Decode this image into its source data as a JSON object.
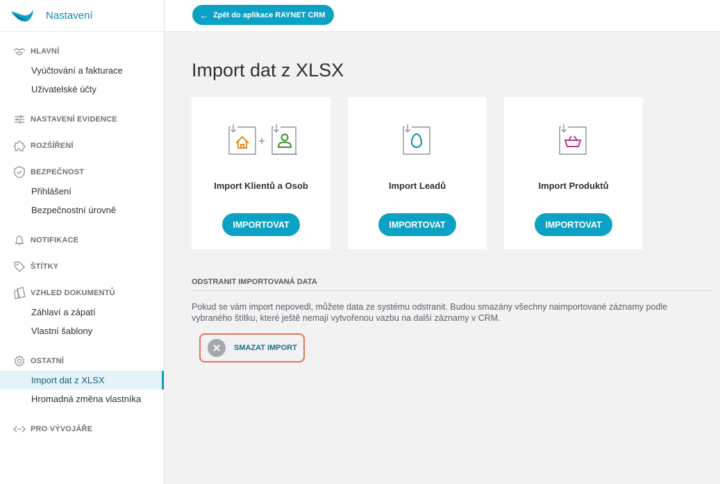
{
  "sidebar": {
    "brand_title": "Nastavení",
    "sections": [
      {
        "label": "HLAVNÍ",
        "icon": "handshake-icon",
        "items": [
          "Vyúčtování a fakturace",
          "Uživatelské účty"
        ]
      },
      {
        "label": "NASTAVENÍ EVIDENCE",
        "icon": "sliders-icon",
        "items": []
      },
      {
        "label": "ROZŠÍŘENÍ",
        "icon": "puzzle-icon",
        "items": []
      },
      {
        "label": "BEZPEČNOST",
        "icon": "shield-icon",
        "items": [
          "Přihlášení",
          "Bezpečnostní úrovně"
        ]
      },
      {
        "label": "NOTIFIKACE",
        "icon": "bell-icon",
        "items": []
      },
      {
        "label": "ŠTÍTKY",
        "icon": "tag-icon",
        "items": []
      },
      {
        "label": "VZHLED DOKUMENTŮ",
        "icon": "documents-icon",
        "items": [
          "Záhlaví a zápatí",
          "Vlastní šablony"
        ]
      },
      {
        "label": "OSTATNÍ",
        "icon": "gear-icon",
        "items": [
          "Import dat z XLSX",
          "Hromadná změna vlastníka"
        ]
      },
      {
        "label": "PRO VÝVOJÁŘE",
        "icon": "code-icon",
        "items": []
      }
    ],
    "active_item": "Import dat z XLSX"
  },
  "topbar": {
    "back_label": "Zpět do aplikace RAYNET CRM"
  },
  "main": {
    "title": "Import dat z XLSX",
    "cards": [
      {
        "title": "Import Klientů a Osob",
        "button": "IMPORTOVAT",
        "icons": [
          "house-icon",
          "person-icon"
        ]
      },
      {
        "title": "Import Leadů",
        "button": "IMPORTOVAT",
        "icons": [
          "egg-icon"
        ]
      },
      {
        "title": "Import Produktů",
        "button": "IMPORTOVAT",
        "icons": [
          "basket-icon"
        ]
      }
    ],
    "remove": {
      "heading": "ODSTRANIT IMPORTOVANÁ DATA",
      "description": "Pokud se vám import nepovedl, můžete data ze systému odstranit. Budou smazány všechny naimportované záznamy podle vybraného štítku, které ještě nemají vytvořenou vazbu na další záznamy v CRM.",
      "button": "SMAZAT IMPORT"
    }
  },
  "colors": {
    "accent": "#0da2c4",
    "house": "#e08a1e",
    "person": "#3d8c2b",
    "egg": "#0b8da6",
    "basket": "#b33b8f",
    "highlight": "#e4715a"
  }
}
